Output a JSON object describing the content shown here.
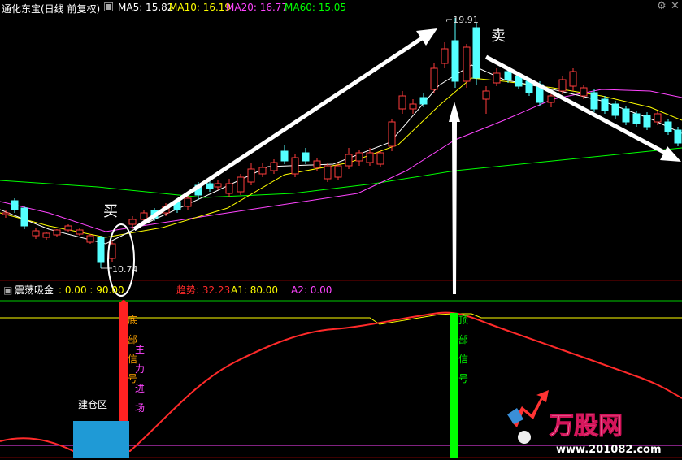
{
  "header": {
    "stock_title": "通化东宝(日线 前复权)",
    "ma5": "MA5: 15.82",
    "ma10": "MA10: 16.19",
    "ma20": "MA20: 16.77",
    "ma60": "MA60: 15.05"
  },
  "main_chart": {
    "high_label": "19.91",
    "low_label": "10.74",
    "buy_label": "买",
    "sell_label": "卖"
  },
  "indicator": {
    "name": "震荡吸金",
    "values": ": 0.00 : 90.00",
    "trend": "趋势: 32.23",
    "a1": "A1: 80.00",
    "a2": "A2: 0.00",
    "bottom_signal": [
      "底",
      "部",
      "信",
      "号"
    ],
    "main_entry": [
      "主",
      "力",
      "进",
      "场"
    ],
    "top_signal": [
      "顶",
      "部",
      "信",
      "号"
    ],
    "build_zone": "建仓区"
  },
  "watermark": {
    "brand": "万股网",
    "url": "www.201082.com"
  },
  "colors": {
    "up": "#ff3c3c",
    "down": "#54ffff",
    "ma5": "#ffffff",
    "ma10": "#ffff00",
    "ma20": "#ff44ff",
    "ma60": "#00ff00",
    "trend_line": "#ff2a2a",
    "a1_line": "#ffff00",
    "bottom_bar": "#ff2222",
    "top_bar": "#00ff00",
    "zone_box": "#1f9ad6"
  }
}
